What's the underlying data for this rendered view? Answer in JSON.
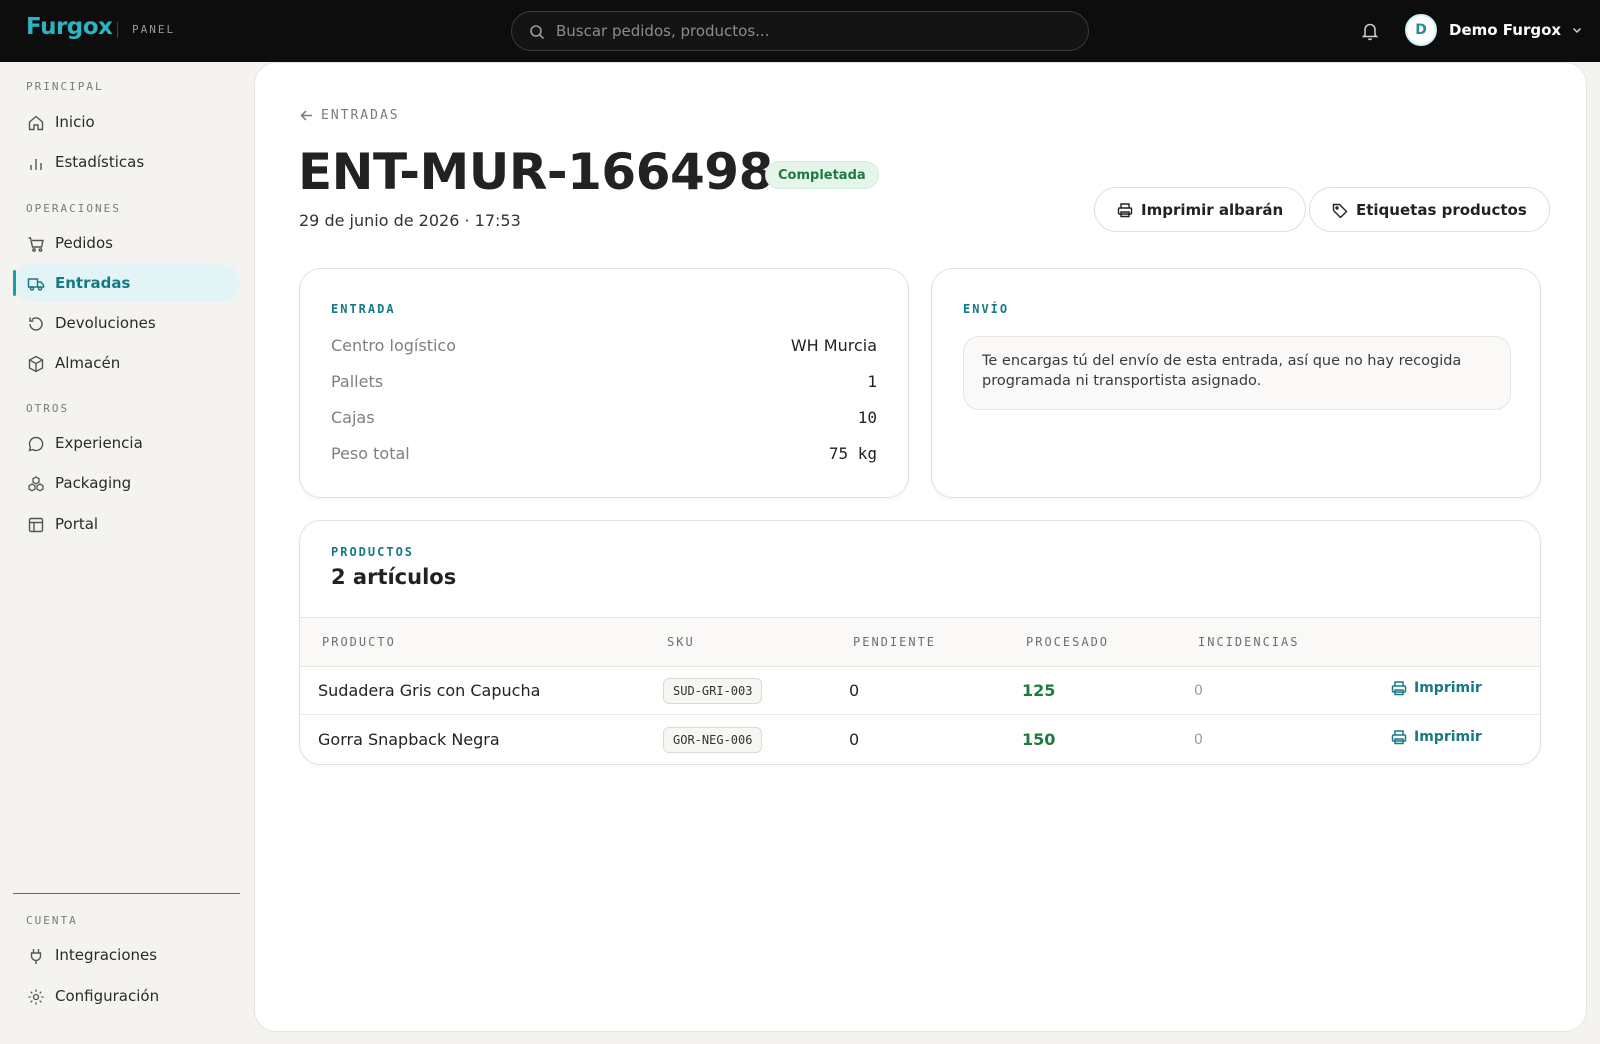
{
  "brand": {
    "logo": "Furgox",
    "sub": "PANEL"
  },
  "search": {
    "placeholder": "Buscar pedidos, productos..."
  },
  "user": {
    "initial": "D",
    "name": "Demo Furgox"
  },
  "sidebar": {
    "sections": [
      {
        "label": "PRINCIPAL"
      },
      {
        "label": "OPERACIONES"
      },
      {
        "label": "OTROS"
      },
      {
        "label": "CUENTA"
      }
    ],
    "items": [
      {
        "label": "Inicio",
        "icon": "home-icon"
      },
      {
        "label": "Estadísticas",
        "icon": "bar-chart-icon"
      },
      {
        "label": "Pedidos",
        "icon": "cart-icon"
      },
      {
        "label": "Entradas",
        "icon": "truck-icon",
        "active": true
      },
      {
        "label": "Devoluciones",
        "icon": "return-icon"
      },
      {
        "label": "Almacén",
        "icon": "box-icon"
      },
      {
        "label": "Experiencia",
        "icon": "chat-icon"
      },
      {
        "label": "Packaging",
        "icon": "boxes-icon"
      },
      {
        "label": "Portal",
        "icon": "layout-icon"
      },
      {
        "label": "Integraciones",
        "icon": "plug-icon"
      },
      {
        "label": "Configuración",
        "icon": "gear-icon"
      }
    ]
  },
  "page": {
    "breadcrumb": "ENTRADAS",
    "title": "ENT-MUR-166498",
    "status": "Completada",
    "date": "29 de junio de 2026 · 17:53",
    "actions": {
      "print_delivery": "Imprimir albarán",
      "product_labels": "Etiquetas productos"
    }
  },
  "entrada": {
    "label": "ENTRADA",
    "rows": [
      {
        "label": "Centro logístico",
        "value": "WH Murcia"
      },
      {
        "label": "Pallets",
        "value": "1"
      },
      {
        "label": "Cajas",
        "value": "10"
      },
      {
        "label": "Peso total",
        "value": "75 kg"
      }
    ]
  },
  "envio": {
    "label": "ENVÍO",
    "note": "Te encargas tú del envío de esta entrada, así que no hay recogida programada ni transportista asignado."
  },
  "productos": {
    "label": "PRODUCTOS",
    "count": "2 artículos",
    "columns": [
      "PRODUCTO",
      "SKU",
      "PENDIENTE",
      "PROCESADO",
      "INCIDENCIAS"
    ],
    "rows": [
      {
        "name": "Sudadera Gris con Capucha",
        "sku": "SUD-GRI-003",
        "pending": "0",
        "processed": "125",
        "incidents": "0",
        "action": "Imprimir"
      },
      {
        "name": "Gorra Snapback Negra",
        "sku": "GOR-NEG-006",
        "pending": "0",
        "processed": "150",
        "incidents": "0",
        "action": "Imprimir"
      }
    ]
  },
  "colors": {
    "accent": "#167a86",
    "success": "#1e7a3d",
    "topbar": "#0d0d0d"
  }
}
